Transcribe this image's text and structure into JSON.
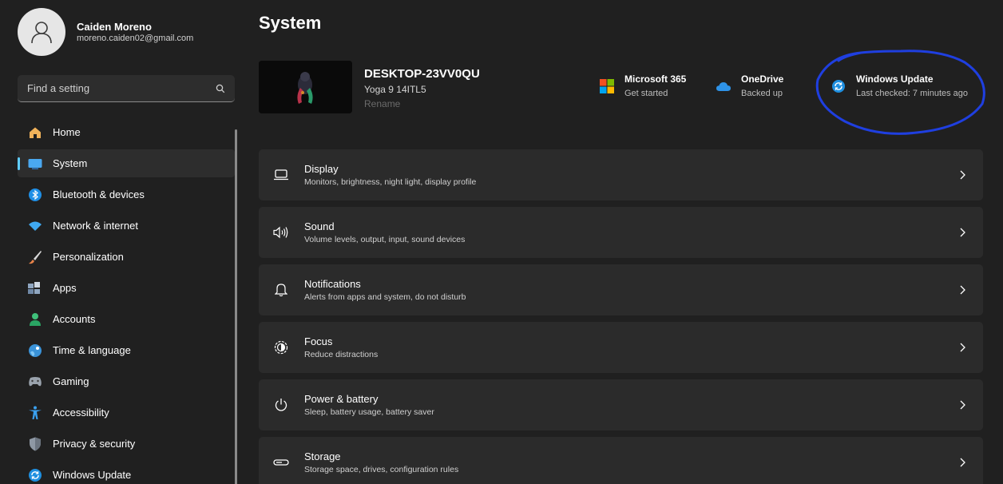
{
  "profile": {
    "name": "Caiden Moreno",
    "email": "moreno.caiden02@gmail.com"
  },
  "search": {
    "placeholder": "Find a setting",
    "icon": "search-icon"
  },
  "sidebar": {
    "items": [
      {
        "label": "Home",
        "icon": "home-icon",
        "active": false
      },
      {
        "label": "System",
        "icon": "system-icon",
        "active": true
      },
      {
        "label": "Bluetooth & devices",
        "icon": "bluetooth-icon",
        "active": false
      },
      {
        "label": "Network & internet",
        "icon": "wifi-icon",
        "active": false
      },
      {
        "label": "Personalization",
        "icon": "brush-icon",
        "active": false
      },
      {
        "label": "Apps",
        "icon": "apps-icon",
        "active": false
      },
      {
        "label": "Accounts",
        "icon": "accounts-icon",
        "active": false
      },
      {
        "label": "Time & language",
        "icon": "globe-icon",
        "active": false
      },
      {
        "label": "Gaming",
        "icon": "gamepad-icon",
        "active": false
      },
      {
        "label": "Accessibility",
        "icon": "accessibility-icon",
        "active": false
      },
      {
        "label": "Privacy & security",
        "icon": "shield-icon",
        "active": false
      },
      {
        "label": "Windows Update",
        "icon": "update-icon",
        "active": false
      }
    ]
  },
  "main": {
    "title": "System",
    "device": {
      "name": "DESKTOP-23VV0QU",
      "model": "Yoga 9 14ITL5",
      "rename_label": "Rename"
    },
    "quick_links": [
      {
        "title": "Microsoft 365",
        "subtitle": "Get started",
        "icon": "microsoft-logo-icon"
      },
      {
        "title": "OneDrive",
        "subtitle": "Backed up",
        "icon": "cloud-icon"
      },
      {
        "title": "Windows Update",
        "subtitle": "Last checked: 7 minutes ago",
        "icon": "update-icon"
      }
    ],
    "settings": [
      {
        "title": "Display",
        "description": "Monitors, brightness, night light, display profile",
        "icon": "display-icon"
      },
      {
        "title": "Sound",
        "description": "Volume levels, output, input, sound devices",
        "icon": "speaker-icon"
      },
      {
        "title": "Notifications",
        "description": "Alerts from apps and system, do not disturb",
        "icon": "bell-icon"
      },
      {
        "title": "Focus",
        "description": "Reduce distractions",
        "icon": "focus-icon"
      },
      {
        "title": "Power & battery",
        "description": "Sleep, battery usage, battery saver",
        "icon": "power-icon"
      },
      {
        "title": "Storage",
        "description": "Storage space, drives, configuration rules",
        "icon": "storage-icon"
      }
    ]
  },
  "colors": {
    "background": "#202020",
    "card": "#2b2b2b",
    "accent": "#60cdff",
    "annotation": "#1f3fe0"
  }
}
